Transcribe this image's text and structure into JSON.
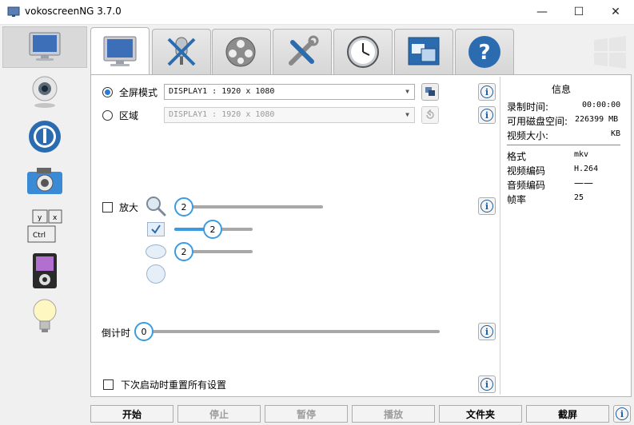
{
  "window": {
    "title": "vokoscreenNG 3.7.0"
  },
  "capture": {
    "fullscreen_label": "全屏模式",
    "fullscreen_display": "DISPLAY1 :  1920 x 1080",
    "area_label": "区域",
    "area_display": "DISPLAY1 :  1920 x 1080"
  },
  "magnifier": {
    "label": "放大",
    "size_value": "2",
    "square_value": "2",
    "ellipse_value": "2",
    "size_fraction": 0.0,
    "square_fraction": 0.4,
    "ellipse_fraction": 0.0
  },
  "countdown": {
    "label": "倒计时",
    "value": "0",
    "fraction": 0.0
  },
  "reset": {
    "label": "下次启动时重置所有设置"
  },
  "info_panel": {
    "title": "信息",
    "rows": [
      {
        "label": "录制时间:",
        "value": "00:00:00"
      },
      {
        "label": "可用磁盘空间:",
        "value": "226399 MB"
      },
      {
        "label": "视频大小:",
        "value": "KB"
      }
    ],
    "format_rows": [
      {
        "label": "格式",
        "value": "mkv"
      },
      {
        "label": "视频编码",
        "value": "H.264"
      },
      {
        "label": "音频编码",
        "value": "——"
      },
      {
        "label": "帧率",
        "value": "25"
      }
    ]
  },
  "buttons": {
    "start": "开始",
    "stop": "停止",
    "pause": "暂停",
    "play": "播放",
    "folder": "文件夹",
    "screenshot": "截屏"
  },
  "colors": {
    "accent": "#3b9be2",
    "info_icon": "#1e5c9e"
  }
}
